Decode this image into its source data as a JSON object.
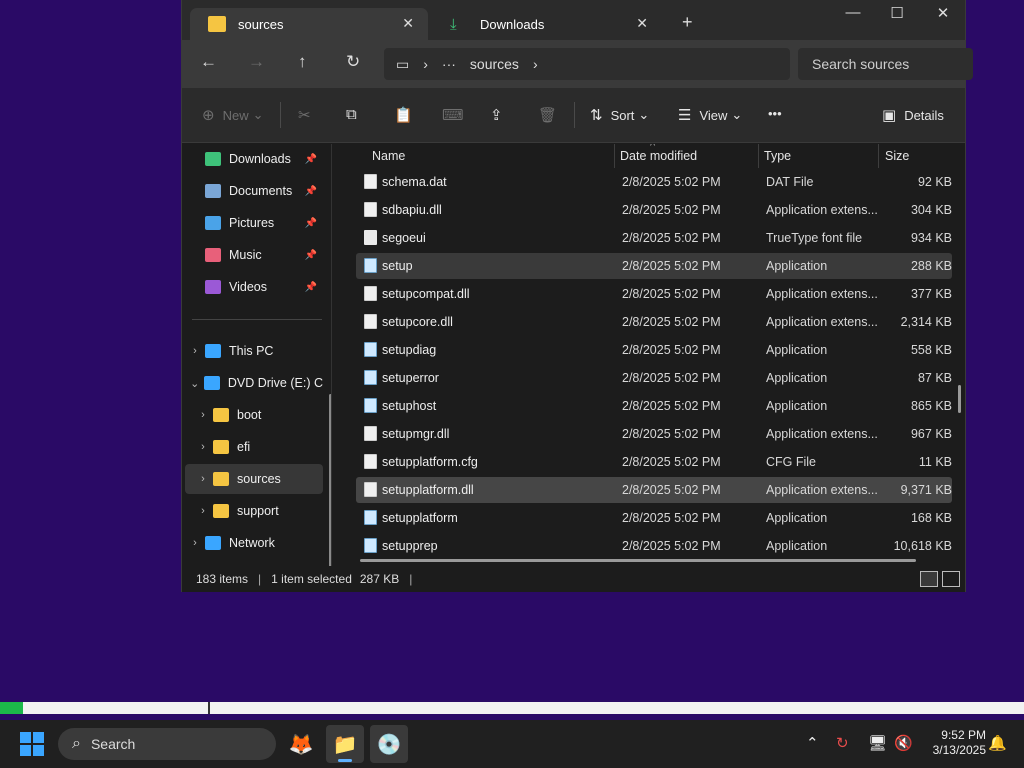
{
  "window": {
    "tabs": [
      {
        "label": "sources",
        "icon": "folder-icon"
      },
      {
        "label": "Downloads",
        "icon": "download-icon"
      }
    ],
    "new_tab": "+",
    "controls": {
      "minimize": "—",
      "maximize": "☐",
      "close": "✕"
    }
  },
  "nav": {
    "back": "←",
    "forward": "→",
    "up": "↑",
    "refresh": "↻",
    "address": {
      "pc_icon": "▭",
      "sep": "›",
      "ellipsis": "···",
      "current": "sources",
      "sep2": "›"
    },
    "search_placeholder": "Search sources"
  },
  "commands": {
    "new": "New",
    "sort": "Sort",
    "view": "View",
    "more": "•••",
    "details": "Details",
    "icons": {
      "new": "⊕",
      "cut": "✂",
      "copy": "⧉",
      "paste": "📋",
      "rename": "⌨",
      "share": "⇪",
      "delete": "🗑",
      "sort": "⇅",
      "view": "☰",
      "details": "▣",
      "chevron": "⌄"
    }
  },
  "sidebar": {
    "quick": [
      {
        "label": "Downloads",
        "color": "#3ec27a"
      },
      {
        "label": "Documents",
        "color": "#7aa6d6"
      },
      {
        "label": "Pictures",
        "color": "#4aa3e8"
      },
      {
        "label": "Music",
        "color": "#e8607a"
      },
      {
        "label": "Videos",
        "color": "#9b59d6"
      }
    ],
    "pin": "📌",
    "tree": [
      {
        "label": "This PC",
        "chev": "›",
        "color": "#3aa6ff"
      },
      {
        "label": "DVD Drive (E:) C",
        "chev": "⌄",
        "color": "#3aa6ff"
      },
      {
        "label": "boot",
        "chev": "›",
        "color": "#f5c542"
      },
      {
        "label": "efi",
        "chev": "›",
        "color": "#f5c542"
      },
      {
        "label": "sources",
        "chev": "›",
        "color": "#f5c542"
      },
      {
        "label": "support",
        "chev": "›",
        "color": "#f5c542"
      },
      {
        "label": "Network",
        "chev": "›",
        "color": "#3aa6ff"
      }
    ]
  },
  "columns": {
    "name": "Name",
    "date": "Date modified",
    "type": "Type",
    "size": "Size",
    "sort_arrow": "^"
  },
  "files": [
    {
      "name": "schema.dat",
      "date": "2/8/2025 5:02 PM",
      "type": "DAT File",
      "size": "92 KB",
      "icon": "doc"
    },
    {
      "name": "sdbapiu.dll",
      "date": "2/8/2025 5:02 PM",
      "type": "Application extens...",
      "size": "304 KB",
      "icon": "doc"
    },
    {
      "name": "segoeui",
      "date": "2/8/2025 5:02 PM",
      "type": "TrueType font file",
      "size": "934 KB",
      "icon": "font"
    },
    {
      "name": "setup",
      "date": "2/8/2025 5:02 PM",
      "type": "Application",
      "size": "288 KB",
      "icon": "app"
    },
    {
      "name": "setupcompat.dll",
      "date": "2/8/2025 5:02 PM",
      "type": "Application extens...",
      "size": "377 KB",
      "icon": "doc"
    },
    {
      "name": "setupcore.dll",
      "date": "2/8/2025 5:02 PM",
      "type": "Application extens...",
      "size": "2,314 KB",
      "icon": "doc"
    },
    {
      "name": "setupdiag",
      "date": "2/8/2025 5:02 PM",
      "type": "Application",
      "size": "558 KB",
      "icon": "app"
    },
    {
      "name": "setuperror",
      "date": "2/8/2025 5:02 PM",
      "type": "Application",
      "size": "87 KB",
      "icon": "app"
    },
    {
      "name": "setuphost",
      "date": "2/8/2025 5:02 PM",
      "type": "Application",
      "size": "865 KB",
      "icon": "app"
    },
    {
      "name": "setupmgr.dll",
      "date": "2/8/2025 5:02 PM",
      "type": "Application extens...",
      "size": "967 KB",
      "icon": "doc"
    },
    {
      "name": "setupplatform.cfg",
      "date": "2/8/2025 5:02 PM",
      "type": "CFG File",
      "size": "11 KB",
      "icon": "doc"
    },
    {
      "name": "setupplatform.dll",
      "date": "2/8/2025 5:02 PM",
      "type": "Application extens...",
      "size": "9,371 KB",
      "icon": "doc"
    },
    {
      "name": "setupplatform",
      "date": "2/8/2025 5:02 PM",
      "type": "Application",
      "size": "168 KB",
      "icon": "app"
    },
    {
      "name": "setupprep",
      "date": "2/8/2025 5:02 PM",
      "type": "Application",
      "size": "10,618 KB",
      "icon": "app"
    }
  ],
  "status": {
    "items": "183 items",
    "sep": "|",
    "selected": "1 item selected",
    "size": "287 KB",
    "sep2": "|"
  },
  "progress": {
    "fraction": 0.022
  },
  "taskbar": {
    "search": "Search",
    "search_icon": "⌕",
    "apps": [
      {
        "name": "firefox",
        "glyph": "🦊"
      },
      {
        "name": "file-explorer",
        "glyph": "📁"
      },
      {
        "name": "setup",
        "glyph": "💿"
      }
    ],
    "tray": {
      "chevron": "⌃",
      "update": "↻",
      "network": "🖥",
      "volume": "🔇",
      "bell": "🔔"
    },
    "time": "9:52 PM",
    "date": "3/13/2025"
  },
  "colors": {
    "accent": "#5fb2ff",
    "folder": "#f5c542",
    "progress": "#1cb84a"
  }
}
